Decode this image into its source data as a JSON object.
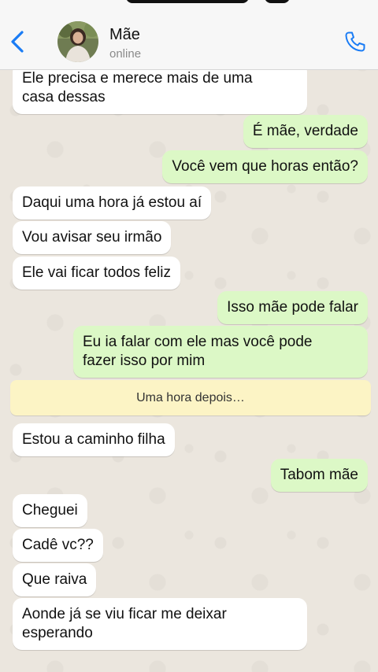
{
  "header": {
    "contact_name": "Mãe",
    "status": "online",
    "back_icon": "chevron-left-icon",
    "call_icon": "phone-icon",
    "accent_color": "#1a7cf5"
  },
  "messages": [
    {
      "from": "them",
      "text": "Ele precisa e merece mais de uma\ncasa dessas"
    },
    {
      "from": "me",
      "text": "É mãe, verdade"
    },
    {
      "from": "me",
      "text": "Você vem que horas então?"
    },
    {
      "from": "them",
      "text": "Daqui uma hora já estou aí"
    },
    {
      "from": "them",
      "text": "Vou avisar seu irmão"
    },
    {
      "from": "them",
      "text": "Ele vai ficar todos feliz"
    },
    {
      "from": "me",
      "text": "Isso mãe pode falar"
    },
    {
      "from": "me",
      "text": "Eu ia falar com ele mas você pode\nfazer isso por mim"
    },
    {
      "from": "system",
      "text": "Uma hora depois…"
    },
    {
      "from": "them",
      "text": "Estou a caminho filha"
    },
    {
      "from": "me",
      "text": "Tabom mãe"
    },
    {
      "from": "them",
      "text": "Cheguei"
    },
    {
      "from": "them",
      "text": "Cadê vc??"
    },
    {
      "from": "them",
      "text": "Que raiva"
    },
    {
      "from": "them",
      "text": "Aonde já se viu ficar me deixar\nesperando"
    }
  ],
  "colors": {
    "incoming_bubble": "#ffffff",
    "outgoing_bubble": "#dcf8c6",
    "system_bubble": "#fcf4c5",
    "wallpaper": "#ebe6de"
  }
}
